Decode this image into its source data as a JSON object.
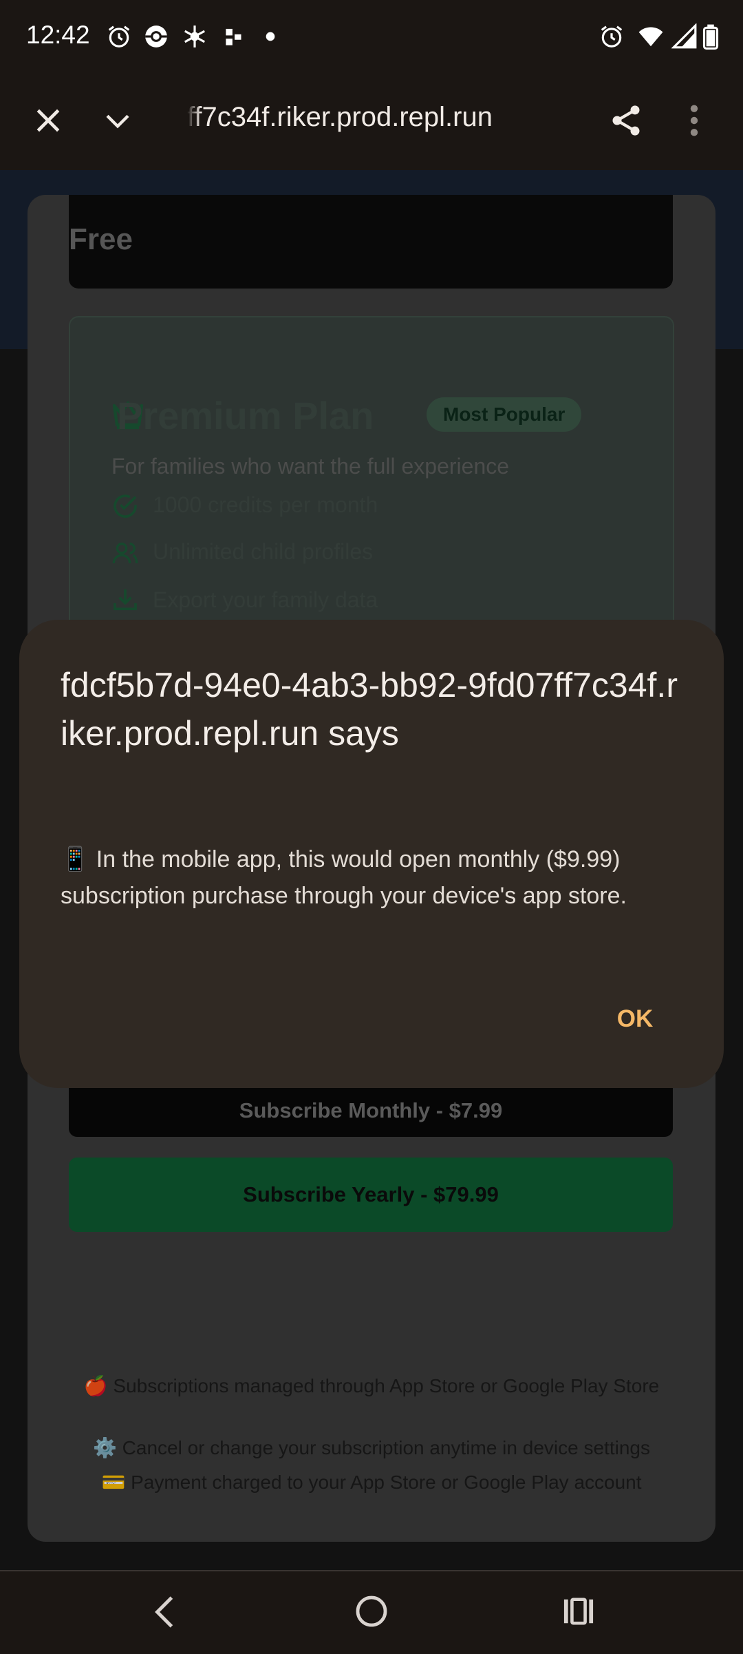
{
  "status_bar": {
    "time": "12:42",
    "left_icons": [
      "alarm-icon",
      "pokeball-icon",
      "snowflake-icon",
      "dots-app-icon",
      "notification-dot-icon"
    ],
    "right_icons": [
      "alarm-icon",
      "wifi-icon",
      "signal-icon",
      "battery-icon"
    ]
  },
  "toolbar": {
    "url": "ff7c34f.riker.prod.repl.run",
    "icons": [
      "close-icon",
      "chevron-down-icon",
      "share-icon",
      "more-vert-icon"
    ]
  },
  "page": {
    "free_plan": {
      "title": "Free"
    },
    "premium_plan": {
      "title": "Premium Plan",
      "badge": "Most Popular",
      "subtitle": "For families who want the full experience",
      "features": [
        {
          "icon": "check-circle-icon",
          "text": "1000 credits per month"
        },
        {
          "icon": "users-icon",
          "text": "Unlimited child profiles"
        },
        {
          "icon": "download-icon",
          "text": "Export your family data"
        }
      ]
    },
    "buttons": {
      "monthly": "Subscribe Monthly - $7.99",
      "yearly": "Subscribe Yearly - $79.99"
    },
    "footer": [
      "🍎 Subscriptions managed through App Store or Google Play Store",
      "⚙️ Cancel or change your subscription anytime in device settings",
      "💳 Payment charged to your App Store or Google Play account"
    ]
  },
  "dialog": {
    "title": "fdcf5b7d-94e0-4ab3-bb92-9fd07ff7c34f.riker.prod.repl.run says",
    "message": "📱 In the mobile app, this would open monthly ($9.99) subscription purchase through your device's app store.",
    "ok_label": "OK"
  },
  "colors": {
    "system_bar": "#1b1613",
    "dialog_bg": "#302923",
    "dialog_accent": "#f5b867",
    "yearly_button": "#0e5b31"
  }
}
